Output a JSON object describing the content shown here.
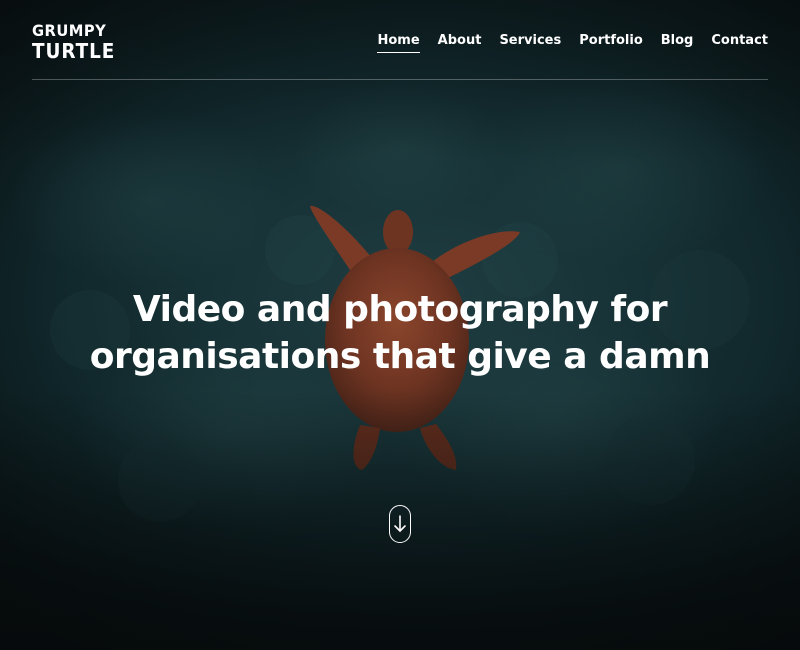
{
  "brand": {
    "logo_line1": "GRUMPY",
    "logo_line2": "TURTLE"
  },
  "nav": {
    "items": [
      {
        "label": "Home",
        "active": true
      },
      {
        "label": "About",
        "active": false
      },
      {
        "label": "Services",
        "active": false
      },
      {
        "label": "Portfolio",
        "active": false
      },
      {
        "label": "Blog",
        "active": false
      },
      {
        "label": "Contact",
        "active": false
      }
    ]
  },
  "hero": {
    "headline_line1": "Video and photography for",
    "headline_line2": "organisations that give a damn",
    "background": "underwater-sea-turtle-over-coral",
    "scroll_icon": "arrow-down-icon"
  },
  "colors": {
    "text": "#ffffff",
    "water_dark": "#0b1416",
    "water_teal": "#1f3d42",
    "turtle": "#7a3a26"
  }
}
